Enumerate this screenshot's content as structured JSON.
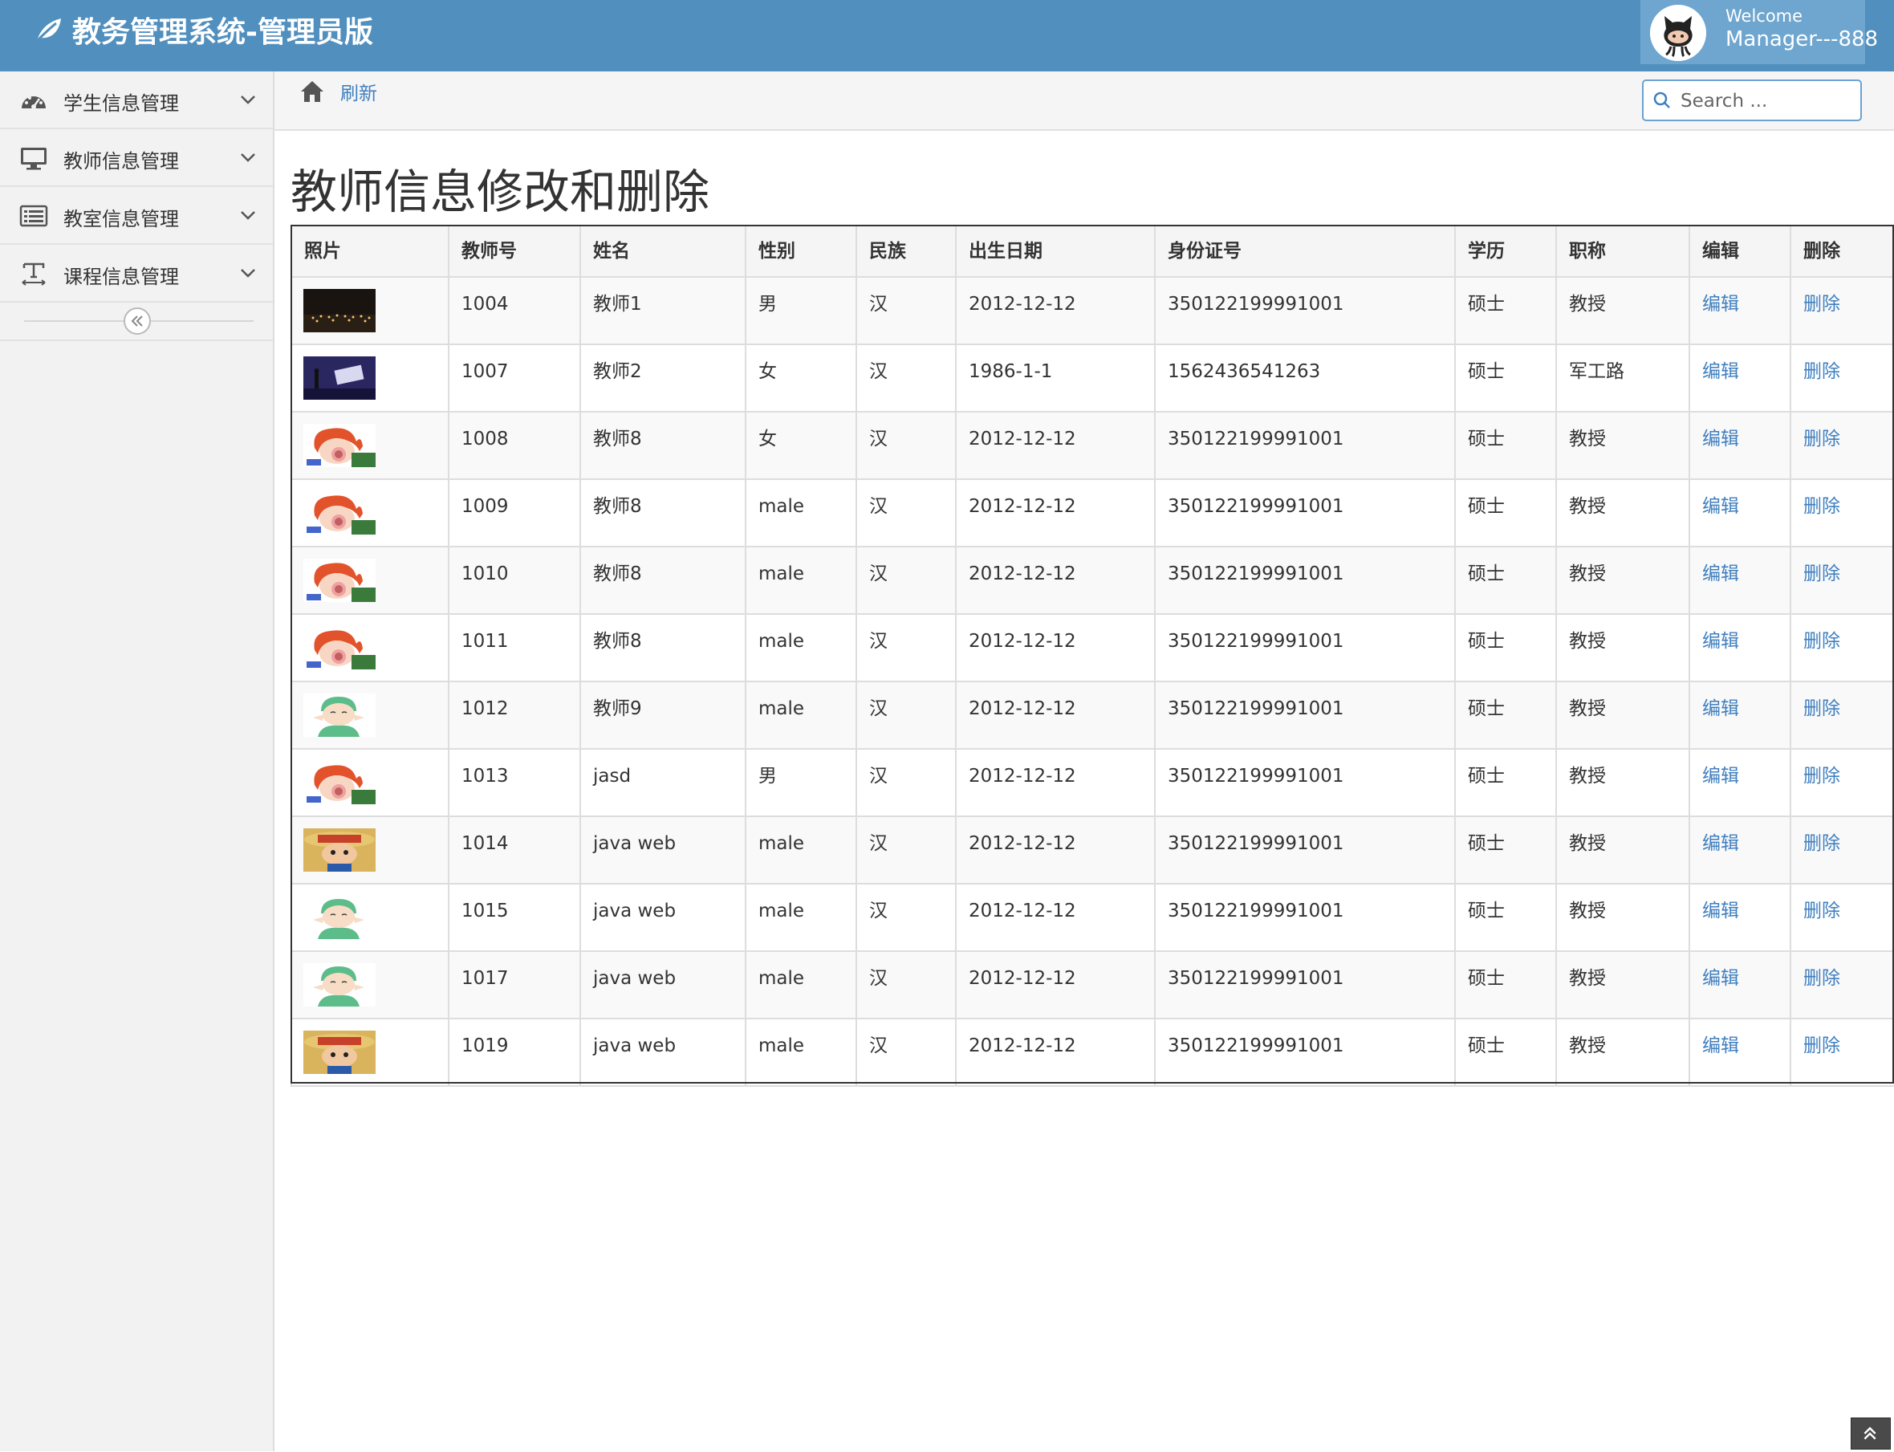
{
  "header": {
    "title": "教务管理系统-管理员版",
    "welcome": "Welcome",
    "user_name": "Manager---888",
    "avatar_icon": "github-octocat-icon"
  },
  "colors": {
    "navbar": "#518fbe",
    "user_box": "#6ea6cf",
    "link": "#3f7fbf"
  },
  "sidebar": {
    "items": [
      {
        "label": "学生信息管理",
        "icon": "dashboard-icon"
      },
      {
        "label": "教师信息管理",
        "icon": "monitor-icon"
      },
      {
        "label": "教室信息管理",
        "icon": "list-icon"
      },
      {
        "label": "课程信息管理",
        "icon": "text-width-icon"
      }
    ]
  },
  "breadcrumb": {
    "refresh": "刷新"
  },
  "search": {
    "placeholder": "Search ..."
  },
  "page_title": "教师信息修改和删除",
  "table": {
    "columns": [
      "照片",
      "教师号",
      "姓名",
      "性别",
      "民族",
      "出生日期",
      "身份证号",
      "学历",
      "职称",
      "编辑",
      "删除"
    ],
    "rows": [
      {
        "photo": "concert-photo",
        "id": "1004",
        "name": "教师1",
        "gender": "男",
        "ethnicity": "汉",
        "birth": "2012-12-12",
        "id_card": "350122199991001",
        "education": "硕士",
        "title": "教授",
        "edit": "编辑",
        "delete": "删除"
      },
      {
        "photo": "stage-photo",
        "id": "1007",
        "name": "教师2",
        "gender": "女",
        "ethnicity": "汉",
        "birth": "1986-1-1",
        "id_card": "1562436541263",
        "education": "硕士",
        "title": "军工路",
        "edit": "编辑",
        "delete": "删除"
      },
      {
        "photo": "red-hair-anime-avatar",
        "id": "1008",
        "name": "教师8",
        "gender": "女",
        "ethnicity": "汉",
        "birth": "2012-12-12",
        "id_card": "350122199991001",
        "education": "硕士",
        "title": "教授",
        "edit": "编辑",
        "delete": "删除"
      },
      {
        "photo": "red-hair-anime-avatar",
        "id": "1009",
        "name": "教师8",
        "gender": "male",
        "ethnicity": "汉",
        "birth": "2012-12-12",
        "id_card": "350122199991001",
        "education": "硕士",
        "title": "教授",
        "edit": "编辑",
        "delete": "删除"
      },
      {
        "photo": "red-hair-anime-avatar",
        "id": "1010",
        "name": "教师8",
        "gender": "male",
        "ethnicity": "汉",
        "birth": "2012-12-12",
        "id_card": "350122199991001",
        "education": "硕士",
        "title": "教授",
        "edit": "编辑",
        "delete": "删除"
      },
      {
        "photo": "red-hair-anime-avatar",
        "id": "1011",
        "name": "教师8",
        "gender": "male",
        "ethnicity": "汉",
        "birth": "2012-12-12",
        "id_card": "350122199991001",
        "education": "硕士",
        "title": "教授",
        "edit": "编辑",
        "delete": "删除"
      },
      {
        "photo": "green-hair-anime-avatar",
        "id": "1012",
        "name": "教师9",
        "gender": "male",
        "ethnicity": "汉",
        "birth": "2012-12-12",
        "id_card": "350122199991001",
        "education": "硕士",
        "title": "教授",
        "edit": "编辑",
        "delete": "删除"
      },
      {
        "photo": "red-hair-anime-avatar",
        "id": "1013",
        "name": "jasd",
        "gender": "男",
        "ethnicity": "汉",
        "birth": "2012-12-12",
        "id_card": "350122199991001",
        "education": "硕士",
        "title": "教授",
        "edit": "编辑",
        "delete": "删除"
      },
      {
        "photo": "straw-hat-anime-avatar",
        "id": "1014",
        "name": "java web",
        "gender": "male",
        "ethnicity": "汉",
        "birth": "2012-12-12",
        "id_card": "350122199991001",
        "education": "硕士",
        "title": "教授",
        "edit": "编辑",
        "delete": "删除"
      },
      {
        "photo": "green-hair-anime-avatar",
        "id": "1015",
        "name": "java web",
        "gender": "male",
        "ethnicity": "汉",
        "birth": "2012-12-12",
        "id_card": "350122199991001",
        "education": "硕士",
        "title": "教授",
        "edit": "编辑",
        "delete": "删除"
      },
      {
        "photo": "green-hair-anime-avatar",
        "id": "1017",
        "name": "java web",
        "gender": "male",
        "ethnicity": "汉",
        "birth": "2012-12-12",
        "id_card": "350122199991001",
        "education": "硕士",
        "title": "教授",
        "edit": "编辑",
        "delete": "删除"
      },
      {
        "photo": "straw-hat-anime-avatar",
        "id": "1019",
        "name": "java web",
        "gender": "male",
        "ethnicity": "汉",
        "birth": "2012-12-12",
        "id_card": "350122199991001",
        "education": "硕士",
        "title": "教授",
        "edit": "编辑",
        "delete": "删除"
      }
    ]
  }
}
